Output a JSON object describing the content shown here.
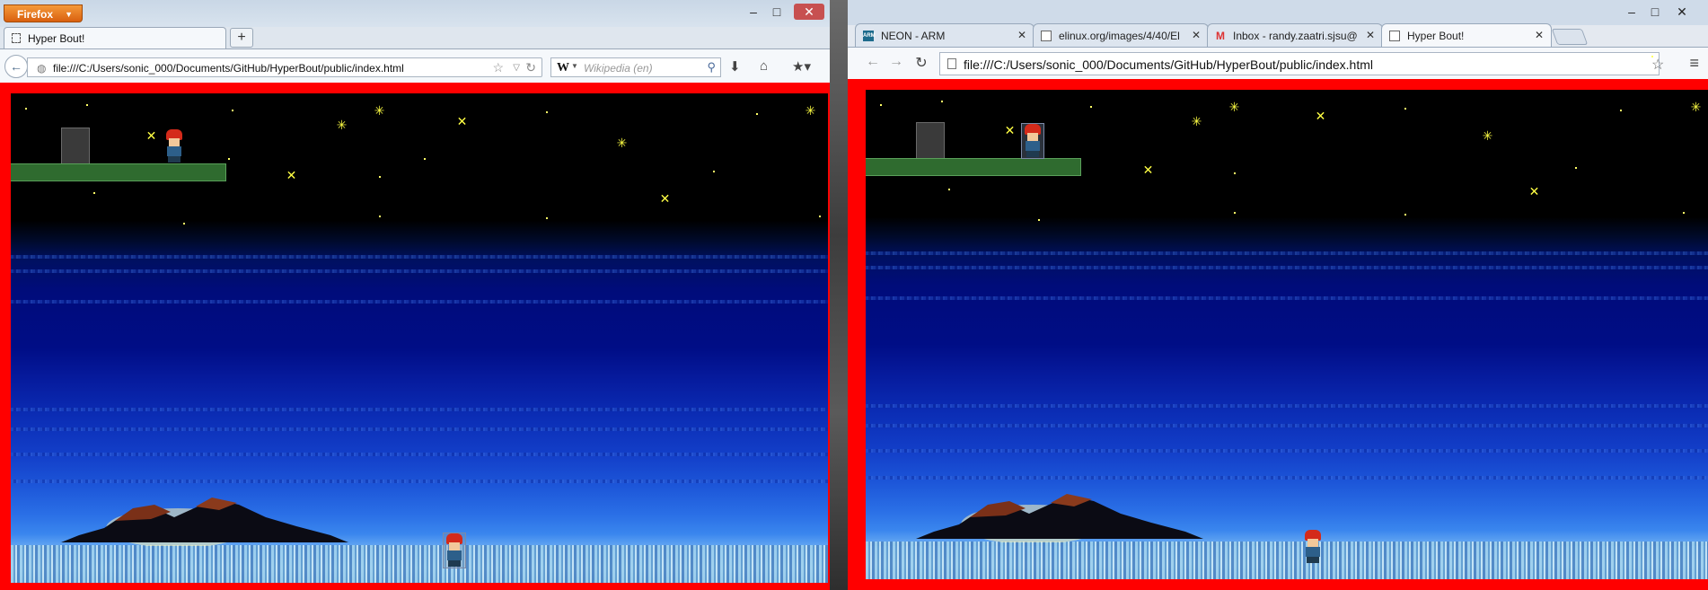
{
  "firefox": {
    "menu_label": "Firefox",
    "tab_title": "Hyper Bout!",
    "new_tab_symbol": "+",
    "url": "file:///C:/Users/sonic_000/Documents/GitHub/HyperBout/public/index.html",
    "search_placeholder": "Wikipedia (en)",
    "search_engine_glyph": "W",
    "window_controls": {
      "minimize": "–",
      "maximize": "□",
      "close": "✕"
    }
  },
  "chrome": {
    "tabs": [
      {
        "label": "NEON - ARM",
        "icon": "arm-favicon-icon",
        "active": false
      },
      {
        "label": "elinux.org/images/4/40/El",
        "icon": "document-icon",
        "active": false
      },
      {
        "label": "Inbox - randy.zaatri.sjsu@",
        "icon": "gmail-icon",
        "active": false
      },
      {
        "label": "Hyper Bout!",
        "icon": "document-icon",
        "active": true
      }
    ],
    "tab_close_symbol": "✕",
    "url": "file:///C:/Users/sonic_000/Documents/GitHub/HyperBout/public/index.html",
    "window_controls": {
      "minimize": "–",
      "maximize": "□",
      "close": "✕"
    }
  },
  "game": {
    "frame_color": "#ff0000",
    "sky_color": "#000000",
    "sea_color": "#0a1f9e",
    "platform_color": "#2f6b2f",
    "star_color": "#ffff44"
  }
}
